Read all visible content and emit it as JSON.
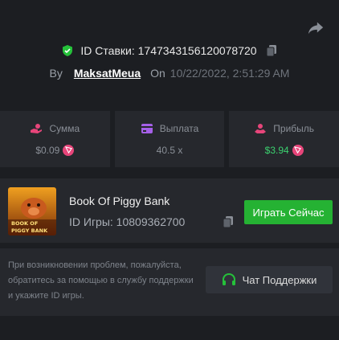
{
  "bet": {
    "id_label": "ID Ставки:",
    "id_value": "1747343156120078720"
  },
  "author": {
    "by_label": "By",
    "username": "MaksatMeua",
    "on_label": "On",
    "date": "10/22/2022, 2:51:29 AM"
  },
  "stats": {
    "amount": {
      "label": "Сумма",
      "value": "$0.09"
    },
    "payout": {
      "label": "Выплата",
      "value": "40.5 x"
    },
    "profit": {
      "label": "Прибыль",
      "value": "$3.94"
    }
  },
  "game": {
    "title": "Book Of Piggy Bank",
    "thumbnail_line1": "BOOK OF",
    "thumbnail_line2": "PIGGY BANK",
    "id_text": "ID Игры: 10809362700",
    "play_label": "Играть Сейчас"
  },
  "support": {
    "help_text": "При возникновении проблем, пожалуйста, обратитесь за помощью в службу поддержки и укажите ID игры.",
    "chat_label": "Чат Поддержки"
  },
  "colors": {
    "background": "#1c1e22",
    "panel": "#26282d",
    "accent_green": "#25b233",
    "profit_green": "#3bd16f",
    "danger_pink": "#e7457a",
    "payout_purple": "#a560e8"
  },
  "icons": {
    "share": "share-icon",
    "verified": "shield-check-icon",
    "copy": "copy-icon",
    "amount": "hand-coin-icon",
    "payout": "wallet-card-icon",
    "profit": "hand-coin-icon",
    "currency": "tron-coin-icon",
    "support": "headphones-icon"
  }
}
